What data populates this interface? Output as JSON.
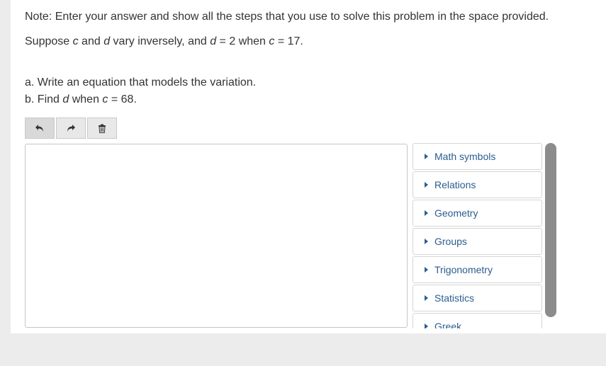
{
  "instructions": {
    "note": "Note: Enter your answer and show all the steps that you use to solve this problem in the space provided.",
    "problem_prefix": "Suppose ",
    "var_c": "c",
    "and_text": " and ",
    "var_d": "d",
    "problem_mid": " vary inversely, and ",
    "eq1": " = 2 when ",
    "eq2": " = 17."
  },
  "questions": {
    "a": "a. Write an equation that models the variation.",
    "b_prefix": "b. Find ",
    "b_mid": " when ",
    "b_suffix": " = 68."
  },
  "toolbar": {
    "undo_icon": "undo-icon",
    "redo_icon": "redo-icon",
    "delete_icon": "trash-icon"
  },
  "palette": {
    "items": [
      "Math symbols",
      "Relations",
      "Geometry",
      "Groups",
      "Trigonometry",
      "Statistics",
      "Greek"
    ]
  },
  "colors": {
    "link": "#2a5d8f",
    "scrollbar": "#8c8c8c"
  }
}
